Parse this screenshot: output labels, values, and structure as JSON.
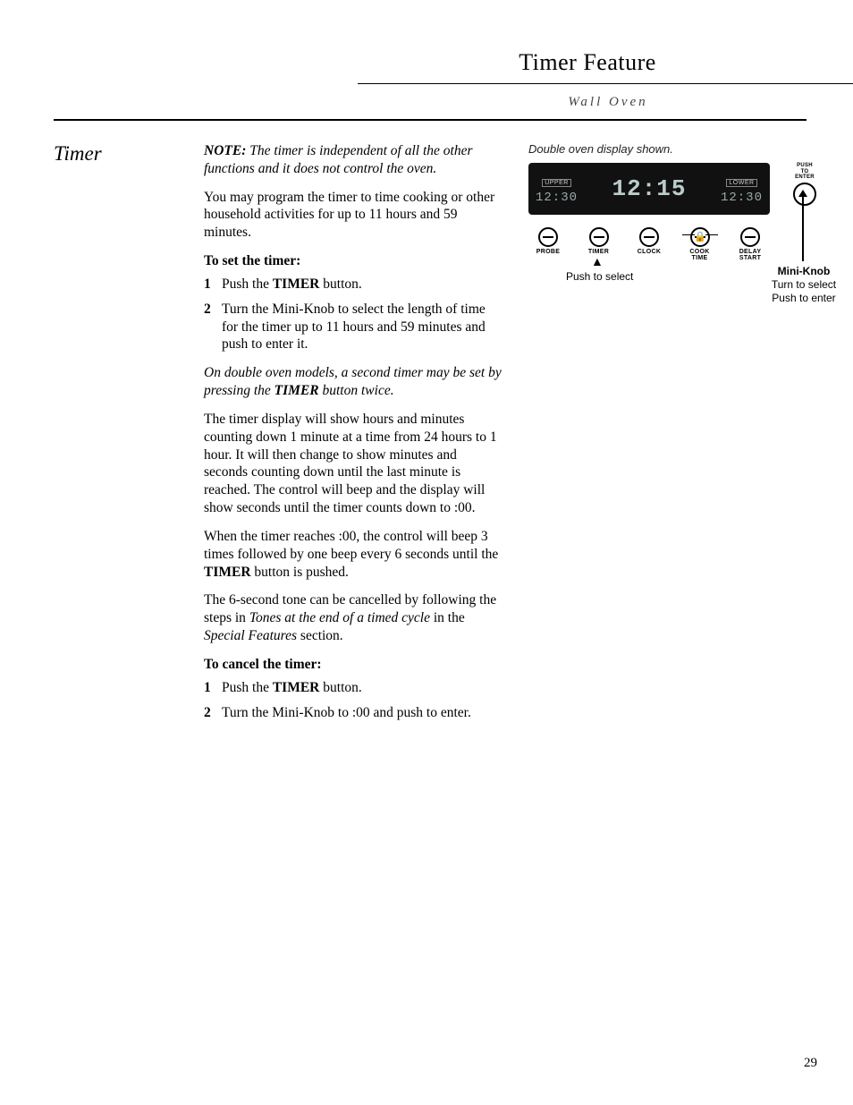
{
  "header": {
    "title": "Timer Feature",
    "subtitle": "Wall Oven"
  },
  "side": {
    "section": "Timer"
  },
  "main": {
    "note_label": "NOTE:",
    "note_text": " The timer is independent of all the other functions and it does not control the oven.",
    "p_program": "You may program the timer to time cooking or other household activities for up to 11 hours and 59 minutes.",
    "set_head": "To set the timer:",
    "set_steps": {
      "s1_a": "Push the ",
      "s1_b": "TIMER",
      "s1_c": " button.",
      "s2": "Turn the Mini-Knob to select the length of time for the timer up to 11 hours and 59 minutes and push to enter it."
    },
    "double_a": "On double oven models, a second timer may be set by pressing the ",
    "double_b": "TIMER",
    "double_c": " button twice.",
    "p_countdown": "The timer display will show hours and minutes counting down 1 minute at a time from 24 hours to 1 hour. It will then change to show minutes and seconds counting down until the last minute is reached. The control will beep and the display will show seconds until the timer counts down to :00.",
    "p_reach_a": "When the timer reaches :00, the control will beep 3 times followed by one beep every 6 seconds until the ",
    "p_reach_b": "TIMER",
    "p_reach_c": " button is pushed.",
    "p_tone_a": "The 6-second tone can be cancelled by following the steps in ",
    "p_tone_b": "Tones at the end of a timed cycle",
    "p_tone_c": " in the ",
    "p_tone_d": "Special Features",
    "p_tone_e": " section.",
    "cancel_head": "To cancel the timer:",
    "cancel_steps": {
      "s1_a": "Push the ",
      "s1_b": "TIMER",
      "s1_c": " button.",
      "s2": "Turn the Mini-Knob to :00 and push to enter."
    }
  },
  "figure": {
    "caption": "Double oven display shown.",
    "upper_badge": "UPPER",
    "lower_badge": "LOWER",
    "seg_upper": "12:30",
    "seg_main": "12:15",
    "seg_lower": "12:30",
    "pte_l1": "PUSH",
    "pte_l2": "TO",
    "pte_l3": "ENTER",
    "knobs": {
      "probe": "PROBE",
      "timer": "TIMER",
      "clock": "CLOCK",
      "cook_time_l1": "COOK",
      "cook_time_l2": "TIME",
      "delay_start_l1": "DELAY",
      "delay_start_l2": "START"
    },
    "callout_push": "Push to select",
    "callout_knob_title": "Mini-Knob",
    "callout_knob_l1": "Turn to select",
    "callout_knob_l2": "Push to enter"
  },
  "page_number": "29"
}
